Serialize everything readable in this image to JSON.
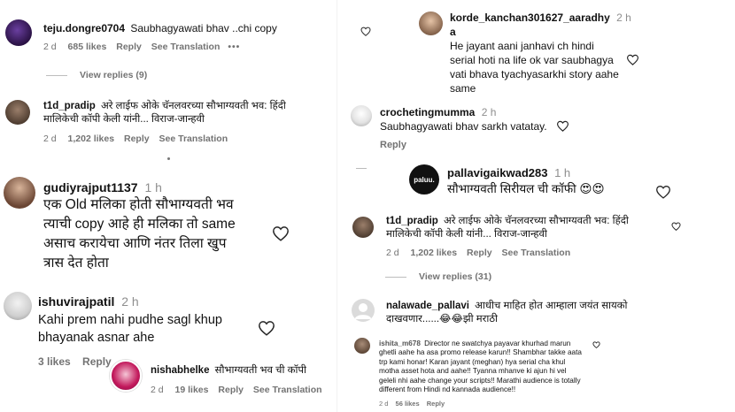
{
  "comments": {
    "c1": {
      "user": "teju.dongre0704",
      "text": "Saubhagyawati bhav ..chi copy",
      "time": "2 d",
      "likes": "685 likes",
      "reply": "Reply",
      "translate": "See Translation",
      "more": "•••",
      "view_replies": "View replies (9)"
    },
    "c2": {
      "user": "t1d_pradip",
      "text1": "अरे लाईफ ओके चॅनलवरच्या सौभाग्यवती भव: हिंदी",
      "text2": "मालिकेची कॉपी केली यांनी... विराज-जान्हवी",
      "time": "2 d",
      "likes": "1,202 likes",
      "reply": "Reply",
      "translate": "See Translation"
    },
    "c3": {
      "user": "gudiyrajput1137",
      "time": "1 h",
      "line1": "एक Old मलिका होती सौभाग्यवती भव",
      "line2": "त्याची copy आहे ही मलिका तो same",
      "line3": "असाच करायेचा आणि नंतर तिला खुप",
      "line4": "त्रास देत होता"
    },
    "c4": {
      "user": "ishuvirajpatil",
      "time": "2 h",
      "line1": "Kahi prem nahi pudhe sagl khup",
      "line2": "bhayanak asnar ahe",
      "likes": "3 likes",
      "reply": "Reply"
    },
    "c5": {
      "user": "nishabhelke",
      "text": "सौभाग्यवती भव ची कॉपी",
      "time": "2 d",
      "likes": "19 likes",
      "reply": "Reply",
      "translate": "See Translation"
    },
    "r1": {
      "user": "korde_kanchan301627_aaradhy",
      "user_tail": "a",
      "time": "2 h",
      "line1": "He jayant aani janhavi ch hindi",
      "line2": "serial hoti na life ok var saubhagya",
      "line3": "vati bhava tyachyasarkhi story aahe",
      "line4": "same"
    },
    "r2": {
      "user": "crochetingmumma",
      "time": "2 h",
      "text": "Saubhagyawati bhav sarkh vatatay.",
      "reply": "Reply"
    },
    "r3": {
      "user": "pallavigaikwad283",
      "time": "1 h",
      "text": "सौभाग्यवती सिरीयल ची कॉफी 😍😍",
      "avatar_text": "paluu."
    },
    "r4": {
      "user": "t1d_pradip",
      "text1": "अरे लाईफ ओके चॅनलवरच्या सौभाग्यवती भव: हिंदी",
      "text2": "मालिकेची कॉपी केली यांनी... विराज-जान्हवी",
      "time": "2 d",
      "likes": "1,202 likes",
      "reply": "Reply",
      "translate": "See Translation",
      "view_replies": "View replies (31)"
    },
    "r5": {
      "user": "nalawade_pallavi",
      "text1": "आधीच माहित होत आम्हाला जयंत सायको",
      "text2": "दाखवणार......😂😂झी मराठी"
    },
    "r6": {
      "user": "ishita_m678",
      "line1": "Director ne swatchya payavar khurhad marun",
      "line2": "ghetli aahe ha asa promo release karun!! Shambhar takke aata",
      "line3": "trp kami honar! Karan jayant (meghan) hya serial cha khul",
      "line4": "motha asset hota and aahe!! Tyanna mhanve ki ajun hi vel",
      "line5": "geleli nhi aahe change your scripts!! Marathi audience is totally",
      "line6": "different from Hindi nd kannada audience!!",
      "time": "2 d",
      "likes": "56 likes",
      "reply": "Reply"
    }
  }
}
